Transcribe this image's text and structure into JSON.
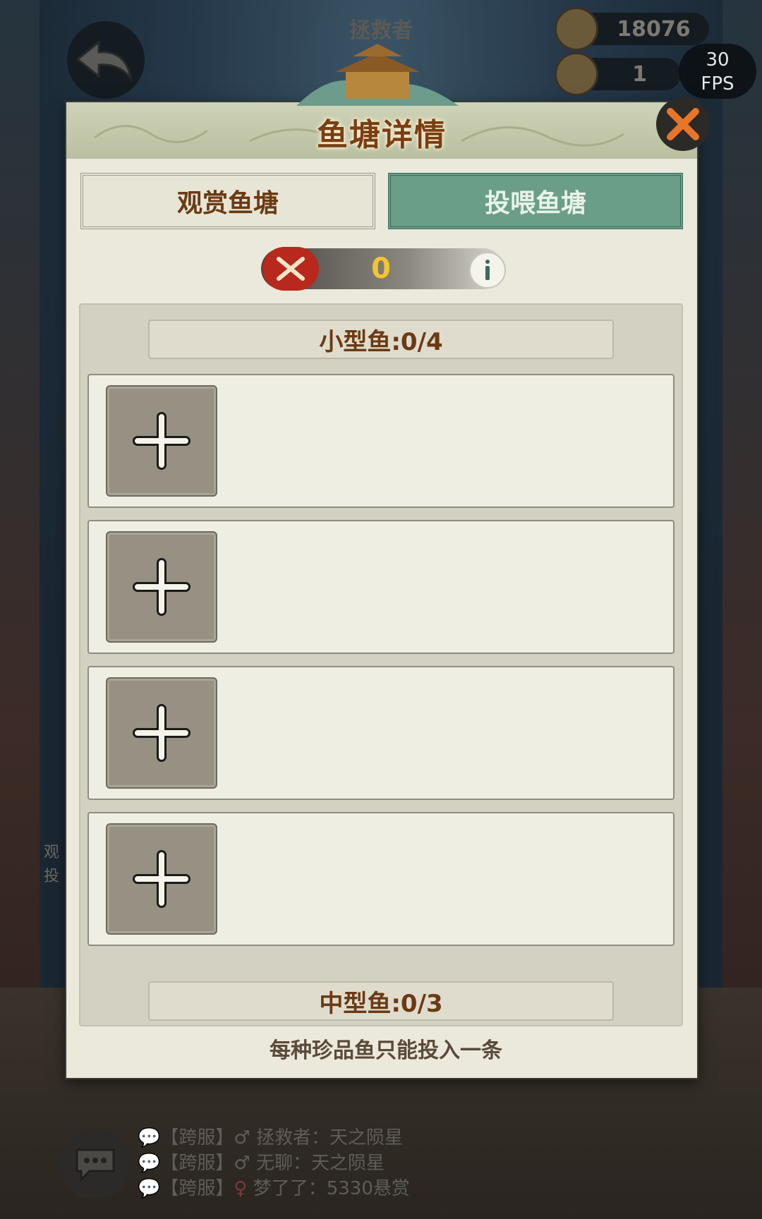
{
  "background": {
    "rescuer_label": "拯救者",
    "currency_1": {
      "icon": "fish-coin-icon",
      "value": "18076"
    },
    "currency_2": {
      "icon": "fish-token-icon",
      "value": "1"
    },
    "fps": {
      "value": "30",
      "label": "FPS"
    },
    "side_text": [
      "观",
      "投"
    ],
    "chat": [
      {
        "channel": "【跨服】",
        "gender": "male",
        "text": "拯救者：天之陨星"
      },
      {
        "channel": "【跨服】",
        "gender": "male",
        "text": "无聊：天之陨星"
      },
      {
        "channel": "【跨服】",
        "gender": "female",
        "text": "梦了了：5330悬赏"
      }
    ]
  },
  "dialog": {
    "title": "鱼塘详情",
    "tabs": [
      {
        "label": "观赏鱼塘",
        "active": false
      },
      {
        "label": "投喂鱼塘",
        "active": true
      }
    ],
    "power_value": "0",
    "small_fish_header": "小型鱼:0/4",
    "small_fish_slots": 4,
    "medium_fish_header": "中型鱼:0/3",
    "footer_note": "每种珍品鱼只能投入一条"
  },
  "colors": {
    "title": "#7a3e12",
    "active_tab": "#6a9e88",
    "power_value": "#f5c531",
    "close_x": "#e8752a"
  }
}
